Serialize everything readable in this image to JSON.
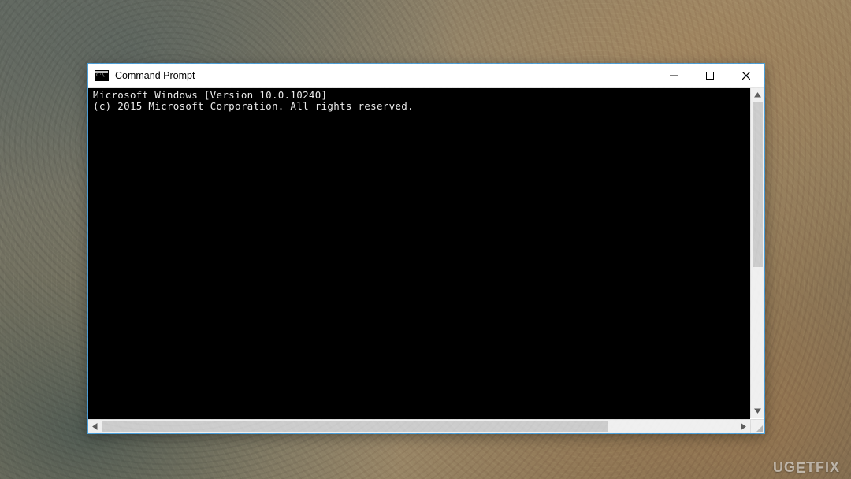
{
  "window": {
    "title": "Command Prompt",
    "icon_name": "command-prompt-icon"
  },
  "terminal": {
    "line1": "Microsoft Windows [Version 10.0.10240]",
    "line2": "(c) 2015 Microsoft Corporation. All rights reserved."
  },
  "watermark": {
    "text_prefix": "UG",
    "text_e": "E",
    "text_suffix": "TFIX"
  }
}
